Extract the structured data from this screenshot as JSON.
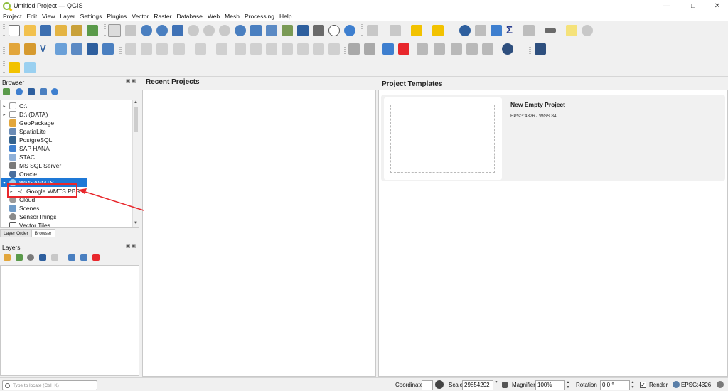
{
  "window": {
    "title": "Untitled Project — QGIS",
    "controls": {
      "minimize": "—",
      "maximize": "□",
      "close": "✕"
    }
  },
  "menu": [
    "Project",
    "Edit",
    "View",
    "Layer",
    "Settings",
    "Plugins",
    "Vector",
    "Raster",
    "Database",
    "Web",
    "Mesh",
    "Processing",
    "Help"
  ],
  "browser": {
    "title": "Browser",
    "tree": [
      {
        "label": "C:\\",
        "icon": "folder-icon",
        "expander": "▸"
      },
      {
        "label": "D:\\ (DATA)",
        "icon": "folder-icon",
        "expander": "▸"
      },
      {
        "label": "GeoPackage",
        "icon": "geopackage-icon",
        "expander": ""
      },
      {
        "label": "SpatiaLite",
        "icon": "spatialite-icon",
        "expander": ""
      },
      {
        "label": "PostgreSQL",
        "icon": "postgresql-icon",
        "expander": ""
      },
      {
        "label": "SAP HANA",
        "icon": "sap-hana-icon",
        "expander": ""
      },
      {
        "label": "STAC",
        "icon": "stac-icon",
        "expander": ""
      },
      {
        "label": "MS SQL Server",
        "icon": "mssql-icon",
        "expander": ""
      },
      {
        "label": "Oracle",
        "icon": "oracle-icon",
        "expander": ""
      },
      {
        "label": "WMS/WMTS",
        "icon": "wms-icon",
        "expander": "▾",
        "selected": true
      },
      {
        "label": "Google WMTS PBS",
        "icon": "wms-connection-icon",
        "expander": "▸",
        "child": true
      },
      {
        "label": "Cloud",
        "icon": "cloud-icon",
        "expander": ""
      },
      {
        "label": "Scenes",
        "icon": "scenes-icon",
        "expander": ""
      },
      {
        "label": "SensorThings",
        "icon": "sensorthings-icon",
        "expander": ""
      },
      {
        "label": "Vector Tiles",
        "icon": "vector-tiles-icon",
        "expander": ""
      }
    ]
  },
  "panel_tabs": [
    "Layer Order",
    "Browser"
  ],
  "layers": {
    "title": "Layers"
  },
  "recent_projects": {
    "title": "Recent Projects"
  },
  "project_templates": {
    "title": "Project Templates",
    "items": [
      {
        "name": "New Empty Project",
        "crs": "EPSG:4326 - WGS 84"
      }
    ]
  },
  "status": {
    "locator_placeholder": "Type to locate (Ctrl+K)",
    "coordinate_label": "Coordinate",
    "coordinate_value": "",
    "scale_label": "Scale",
    "scale_value": "29854292",
    "magnifier_label": "Magnifier",
    "magnifier_value": "100%",
    "rotation_label": "Rotation",
    "rotation_value": "0.0 °",
    "render_label": "Render",
    "render_checked": "✓",
    "crs": "EPSG:4326"
  },
  "colors": {
    "annotation": "#e8272c",
    "selection": "#1e78d6"
  }
}
